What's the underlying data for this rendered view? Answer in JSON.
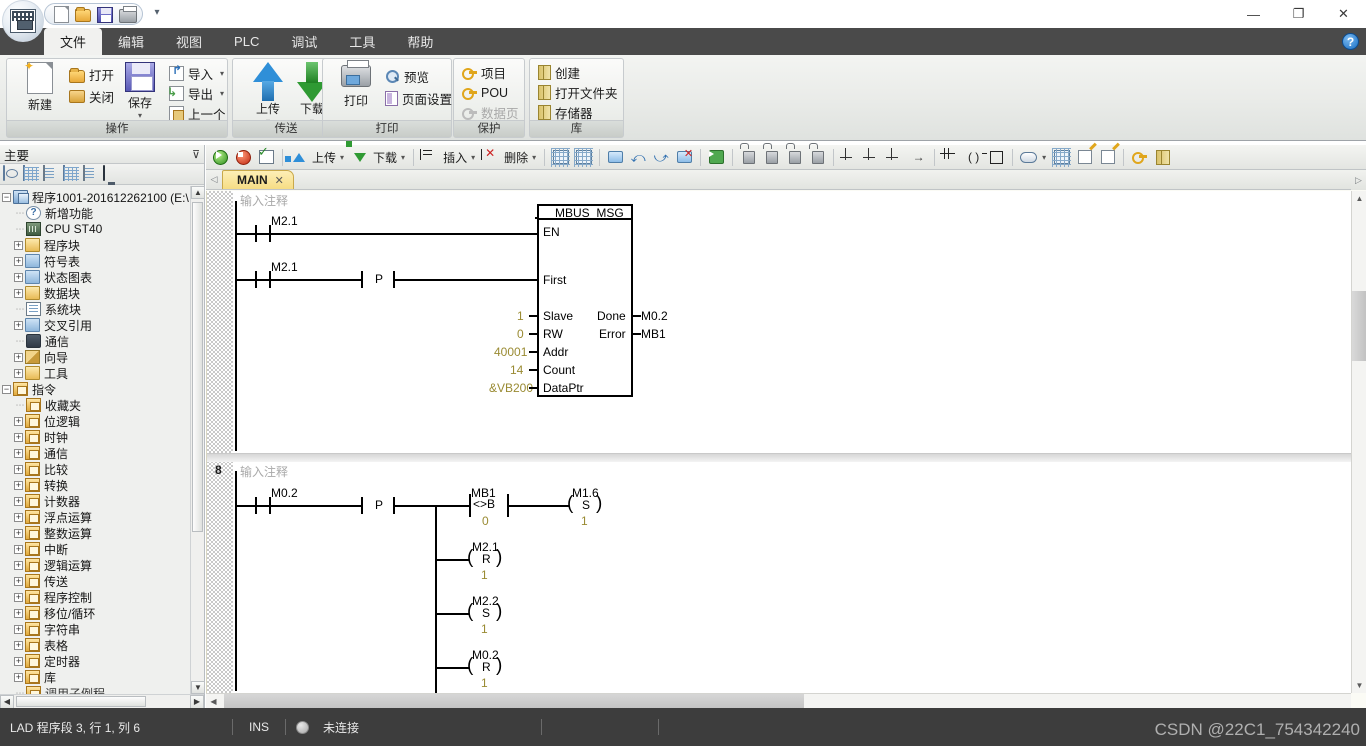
{
  "window": {
    "quick_access": [
      "new-icon",
      "open-icon",
      "save-icon",
      "print-icon"
    ],
    "quick_access_dropdown": "▾",
    "minimize": "—",
    "maximize": "❐",
    "close": "✕",
    "help": "?"
  },
  "menu": {
    "tabs": [
      {
        "label": "文件",
        "active": true
      },
      {
        "label": "编辑",
        "active": false
      },
      {
        "label": "视图",
        "active": false
      },
      {
        "label": "PLC",
        "active": false
      },
      {
        "label": "调试",
        "active": false
      },
      {
        "label": "工具",
        "active": false
      },
      {
        "label": "帮助",
        "active": false
      }
    ]
  },
  "ribbon": {
    "groups": [
      {
        "title": "操作",
        "big": [
          {
            "label": "新建",
            "icon": "new-document-icon"
          },
          {
            "label": "保存",
            "icon": "save-icon",
            "has_caret": true
          }
        ],
        "small": [
          {
            "label": "打开",
            "icon": "open-folder-icon"
          },
          {
            "label": "关闭",
            "icon": "close-folder-icon"
          },
          {
            "label": "导入",
            "icon": "import-icon",
            "caret": "▾"
          },
          {
            "label": "导出",
            "icon": "export-icon",
            "caret": "▾"
          },
          {
            "label": "上一个",
            "icon": "previous-icon",
            "caret": "▾"
          }
        ]
      },
      {
        "title": "传送",
        "big": [
          {
            "label": "上传",
            "icon": "upload-arrow-icon",
            "has_caret": true
          },
          {
            "label": "下载",
            "icon": "download-arrow-icon",
            "has_caret": true
          }
        ],
        "small": []
      },
      {
        "title": "打印",
        "big": [
          {
            "label": "打印",
            "icon": "printer-icon"
          }
        ],
        "small": [
          {
            "label": "预览",
            "icon": "preview-icon"
          },
          {
            "label": "页面设置",
            "icon": "page-setup-icon"
          }
        ]
      },
      {
        "title": "保护",
        "big": [],
        "small": [
          {
            "label": "项目",
            "icon": "key-icon"
          },
          {
            "label": "POU",
            "icon": "key-icon"
          },
          {
            "label": "数据页",
            "icon": "key-icon",
            "disabled": true
          }
        ]
      },
      {
        "title": "库",
        "big": [],
        "small": [
          {
            "label": "创建",
            "icon": "library-create-icon"
          },
          {
            "label": "打开文件夹",
            "icon": "library-open-folder-icon"
          },
          {
            "label": "存储器",
            "icon": "library-memory-icon"
          }
        ]
      }
    ]
  },
  "left_panel": {
    "title": "主要",
    "pin": "pin-icon",
    "toolbar_icons": [
      "window-icon",
      "grid-icon",
      "document-icon",
      "table-icon",
      "symbol-icon",
      "monitor-icon"
    ],
    "tree": [
      {
        "label": "程序1001-201612262100 (E:\\",
        "indent": 0,
        "expander": "−",
        "icon": "project-icon"
      },
      {
        "label": "新增功能",
        "indent": 1,
        "expander": "",
        "icon": "question-icon"
      },
      {
        "label": "CPU ST40",
        "indent": 1,
        "expander": "",
        "icon": "cpu-icon"
      },
      {
        "label": "程序块",
        "indent": 1,
        "expander": "+",
        "icon": "folder-icon"
      },
      {
        "label": "符号表",
        "indent": 1,
        "expander": "+",
        "icon": "folder-blue-icon"
      },
      {
        "label": "状态图表",
        "indent": 1,
        "expander": "+",
        "icon": "folder-blue-icon"
      },
      {
        "label": "数据块",
        "indent": 1,
        "expander": "+",
        "icon": "folder-icon"
      },
      {
        "label": "系统块",
        "indent": 1,
        "expander": "",
        "icon": "system-icon"
      },
      {
        "label": "交叉引用",
        "indent": 1,
        "expander": "+",
        "icon": "folder-blue-icon"
      },
      {
        "label": "通信",
        "indent": 1,
        "expander": "",
        "icon": "monitor-icon"
      },
      {
        "label": "向导",
        "indent": 1,
        "expander": "+",
        "icon": "wizard-icon"
      },
      {
        "label": "工具",
        "indent": 1,
        "expander": "+",
        "icon": "folder-icon"
      },
      {
        "label": "指令",
        "indent": 0,
        "expander": "−",
        "icon": "instruction-icon"
      },
      {
        "label": "收藏夹",
        "indent": 1,
        "expander": "",
        "icon": "favorites-icon"
      },
      {
        "label": "位逻辑",
        "indent": 1,
        "expander": "+",
        "icon": "bit-logic-icon"
      },
      {
        "label": "时钟",
        "indent": 1,
        "expander": "+",
        "icon": "clock-icon"
      },
      {
        "label": "通信",
        "indent": 1,
        "expander": "+",
        "icon": "comm-icon"
      },
      {
        "label": "比较",
        "indent": 1,
        "expander": "+",
        "icon": "compare-icon"
      },
      {
        "label": "转换",
        "indent": 1,
        "expander": "+",
        "icon": "convert-icon"
      },
      {
        "label": "计数器",
        "indent": 1,
        "expander": "+",
        "icon": "counter-icon"
      },
      {
        "label": "浮点运算",
        "indent": 1,
        "expander": "+",
        "icon": "float-math-icon"
      },
      {
        "label": "整数运算",
        "indent": 1,
        "expander": "+",
        "icon": "int-math-icon"
      },
      {
        "label": "中断",
        "indent": 1,
        "expander": "+",
        "icon": "interrupt-icon"
      },
      {
        "label": "逻辑运算",
        "indent": 1,
        "expander": "+",
        "icon": "logic-op-icon"
      },
      {
        "label": "传送",
        "indent": 1,
        "expander": "+",
        "icon": "move-icon"
      },
      {
        "label": "程序控制",
        "indent": 1,
        "expander": "+",
        "icon": "program-control-icon"
      },
      {
        "label": "移位/循环",
        "indent": 1,
        "expander": "+",
        "icon": "shift-rotate-icon"
      },
      {
        "label": "字符串",
        "indent": 1,
        "expander": "+",
        "icon": "string-icon"
      },
      {
        "label": "表格",
        "indent": 1,
        "expander": "+",
        "icon": "table-icon"
      },
      {
        "label": "定时器",
        "indent": 1,
        "expander": "+",
        "icon": "timer-icon"
      },
      {
        "label": "库",
        "indent": 1,
        "expander": "+",
        "icon": "library-icon"
      },
      {
        "label": "调用子例程",
        "indent": 1,
        "expander": "",
        "icon": "subroutine-icon"
      }
    ]
  },
  "editor": {
    "toolbar": {
      "run_label": "",
      "upload_label": "上传",
      "download_label": "下载",
      "insert_label": "插入",
      "delete_label": "删除",
      "caret": "▾"
    },
    "tab": {
      "label": "MAIN",
      "close": "✕",
      "nav_left": "◁",
      "nav_right": "▷"
    }
  },
  "ladder": {
    "networks": [
      {
        "number": "",
        "comment": "输入注释",
        "rows": [
          {
            "type": "contact",
            "label": "M2.1"
          },
          {
            "type": "contact",
            "label": "M2.1",
            "extra": "P"
          }
        ],
        "block": {
          "title": "MBUS_MSG",
          "en": "EN",
          "first": "First",
          "inputs": [
            {
              "name": "Slave",
              "value": "1"
            },
            {
              "name": "RW",
              "value": "0"
            },
            {
              "name": "Addr",
              "value": "40001"
            },
            {
              "name": "Count",
              "value": "14"
            },
            {
              "name": "DataPtr",
              "value": "&VB200"
            }
          ],
          "outputs": [
            {
              "name": "Done",
              "value": "M0.2"
            },
            {
              "name": "Error",
              "value": "MB1"
            }
          ]
        }
      },
      {
        "number": "8",
        "comment": "输入注释",
        "contact": "M0.2",
        "pulse": "P",
        "compare": {
          "label": "MB1",
          "op": "<>B",
          "value": "0"
        },
        "coil_main": {
          "label": "M1.6",
          "op": "S",
          "value": "1"
        },
        "coils": [
          {
            "label": "M2.1",
            "op": "R",
            "value": "1"
          },
          {
            "label": "M2.2",
            "op": "S",
            "value": "1"
          },
          {
            "label": "M0.2",
            "op": "R",
            "value": "1"
          }
        ]
      }
    ]
  },
  "status": {
    "position": "LAD 程序段 3, 行 1, 列 6",
    "mode": "INS",
    "connection": "未连接",
    "watermark": "CSDN @22C1_754342240"
  },
  "colors": {
    "accent_tab": "#f6dd84",
    "value_text": "#9a8b33",
    "titlebar": "#4a4a4a",
    "statusbar": "#3d3d3d"
  }
}
